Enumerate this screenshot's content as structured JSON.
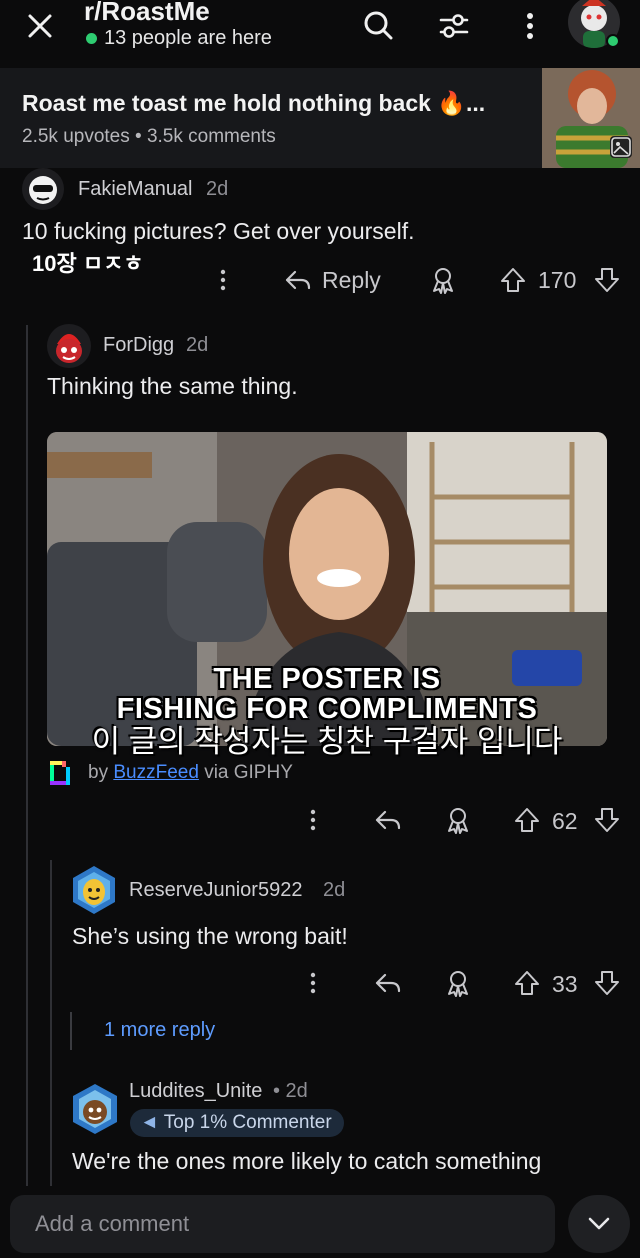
{
  "header": {
    "subreddit": "r/RoastMe",
    "online": "13 people are here"
  },
  "post": {
    "title": "Roast me toast me hold nothing back 🔥...",
    "meta": "2.5k upvotes • 3.5k comments"
  },
  "comments": [
    {
      "user": "FakieManual",
      "time": "2d",
      "text": "10 fucking pictures? Get over yourself.",
      "translation": "10장 ㅁㅈㅎ",
      "reply_label": "Reply",
      "votes": "170"
    },
    {
      "user": "ForDigg",
      "time": "2d",
      "text": "Thinking the same thing.",
      "gif": {
        "caption_line1": "THE POSTER IS",
        "caption_line2": "FISHING FOR COMPLIMENTS",
        "caption_korean": "이 글의 작성자는 칭찬 구걸자 입니다",
        "credit_by": "by",
        "credit_source": "BuzzFeed",
        "credit_via": "via GIPHY"
      },
      "votes": "62"
    },
    {
      "user": "ReserveJunior5922",
      "time": "2d",
      "text": "She’s using the wrong bait!",
      "votes": "33"
    },
    {
      "user": "Luddites_Unite",
      "time": "• 2d",
      "badge": "Top 1% Commenter",
      "text": "We're the ones more likely to catch something"
    }
  ],
  "more_replies": "1 more reply",
  "composer": {
    "placeholder": "Add a comment"
  },
  "icons": {
    "close": "close-icon",
    "search": "search-icon",
    "filter": "filter-icon",
    "more": "more-vertical-icon",
    "reply": "reply-arrow-icon",
    "award": "award-icon",
    "upvote": "upvote-icon",
    "downvote": "downvote-icon",
    "chevron": "chevron-down-icon"
  },
  "colors": {
    "background": "#0b0b0c",
    "link": "#4a8dff",
    "online": "#2ecc71"
  }
}
